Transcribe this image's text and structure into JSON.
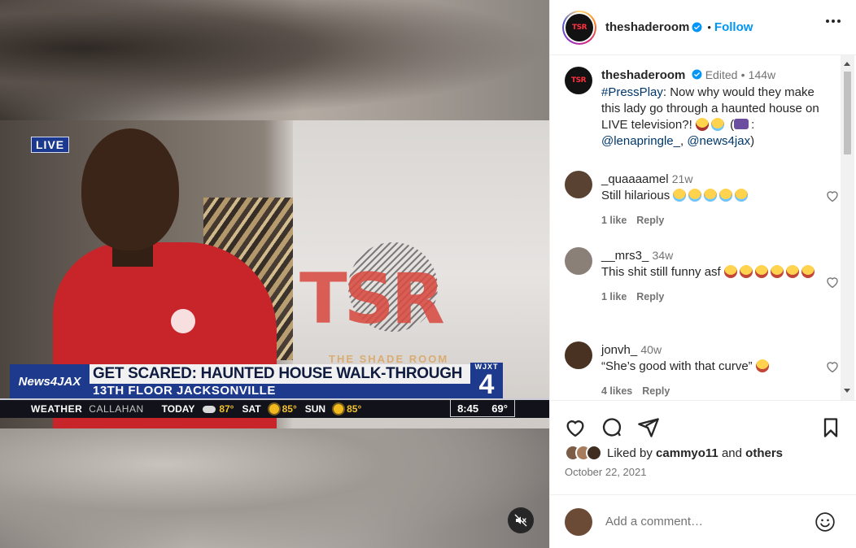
{
  "video": {
    "live_badge": "LIVE",
    "watermark_letters": "TSR",
    "watermark_sub": "THE SHADE ROOM",
    "lower_third": {
      "brand": "News4JAX",
      "headline": "GET SCARED: HAUNTED HOUSE WALK-THROUGH",
      "subhead": "13TH FLOOR JACKSONVILLE",
      "station_call": "WJXT",
      "station_num": "4"
    },
    "weather": {
      "label": "WEATHER",
      "city": "CALLAHAN",
      "days": [
        {
          "day": "TODAY",
          "temp": "87°",
          "icon": "partly-cloudy-icon"
        },
        {
          "day": "SAT",
          "temp": "85°",
          "icon": "sun-icon"
        },
        {
          "day": "SUN",
          "temp": "85°",
          "icon": "sun-icon"
        }
      ],
      "time": "8:45",
      "current_temp": "69°"
    },
    "mute_icon": "speaker-muted-icon"
  },
  "header": {
    "username": "theshaderoom",
    "dot": "•",
    "follow_label": "Follow",
    "avatar_text": "TSR"
  },
  "caption": {
    "username": "theshaderoom",
    "edited": "Edited",
    "dot": "•",
    "age": "144w",
    "hashtag": "#PressPlay",
    "text_after_hashtag": ": Now why would they make this lady go through a haunted house on LIVE television?!",
    "credit_open": "(",
    "credit_colon": ":",
    "mention1": "@lenapringle_",
    "sep": ",",
    "mention2": "@news4jax",
    "credit_close": ")"
  },
  "comments": [
    {
      "username": "_quaaaamel",
      "age": "21w",
      "text": "Still hilarious",
      "likes": "1 like",
      "reply": "Reply"
    },
    {
      "username": "__mrs3_",
      "age": "34w",
      "text": "This shit still funny asf",
      "likes": "1 like",
      "reply": "Reply"
    },
    {
      "username": "jonvh_",
      "age": "40w",
      "text": "“She’s good with that curve”",
      "likes": "4 likes",
      "reply": "Reply"
    }
  ],
  "actions": {
    "icons": [
      "heart-icon",
      "comment-icon",
      "share-icon",
      "bookmark-icon"
    ]
  },
  "likes": {
    "prefix": "Liked by",
    "user": "cammyo11",
    "and": "and",
    "others": "others"
  },
  "date": "October 22, 2021",
  "comment_box": {
    "placeholder": "Add a comment…"
  },
  "colors": {
    "accent": "#0095f6",
    "link": "#00376b",
    "muted": "#737373",
    "text": "#262626"
  }
}
